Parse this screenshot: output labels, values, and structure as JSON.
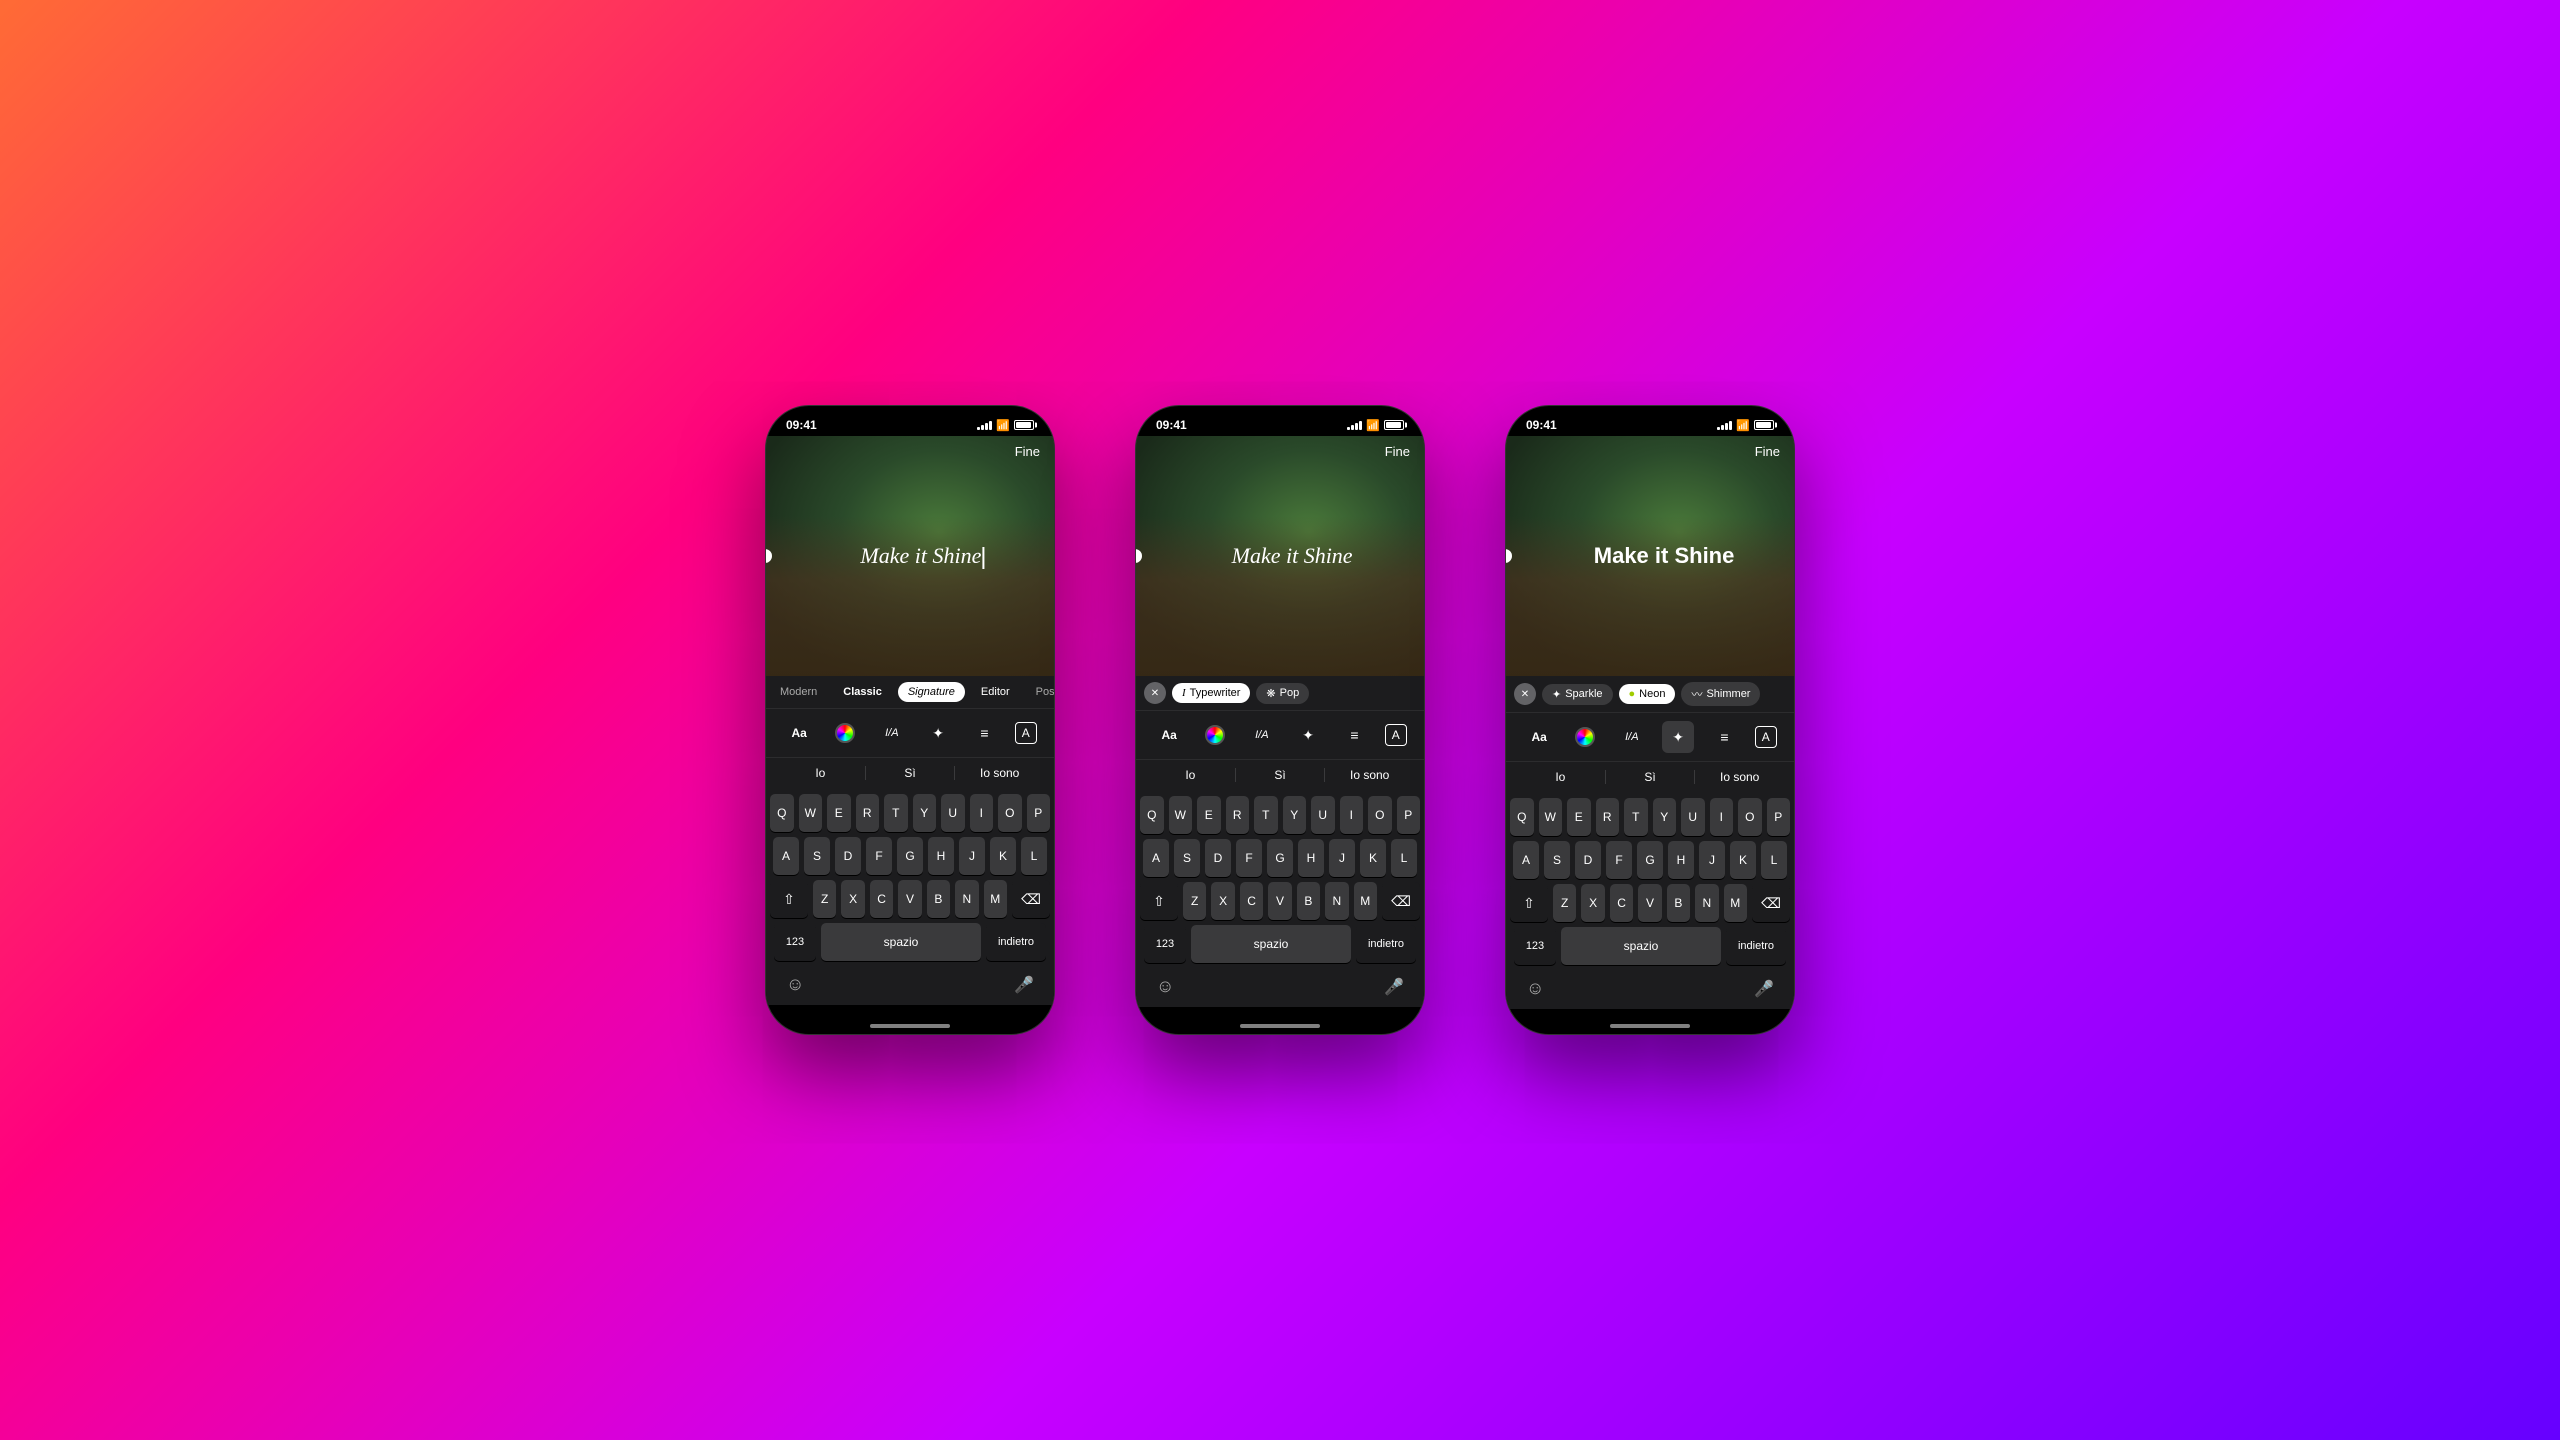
{
  "background": {
    "gradient": "linear-gradient(135deg, #ff6b35 0%, #ff0080 30%, #c800ff 60%, #6600ff 100%)"
  },
  "phones": [
    {
      "id": "phone1",
      "status": {
        "time": "09:41",
        "fine_btn": "Fine"
      },
      "text_overlay": "Make it Shine",
      "text_style": "italic",
      "has_cursor": true,
      "font_selector": {
        "type": "tabs",
        "items": [
          "Modern",
          "Classic",
          "Signature",
          "Editor",
          "Pos"
        ],
        "active": "Signature"
      },
      "toolbar": {
        "items": [
          "Aa",
          "color",
          "I/A",
          "effects",
          "align",
          "A-box"
        ]
      },
      "autocomplete": [
        "Io",
        "Sì",
        "Io sono"
      ],
      "keyboard_rows": [
        [
          "Q",
          "W",
          "E",
          "R",
          "T",
          "Y",
          "U",
          "I",
          "O",
          "P"
        ],
        [
          "A",
          "S",
          "D",
          "F",
          "G",
          "H",
          "J",
          "K",
          "L"
        ],
        [
          "⇧",
          "Z",
          "X",
          "C",
          "V",
          "B",
          "N",
          "M",
          "⌫"
        ],
        [
          "123",
          "spazio",
          "indietro"
        ]
      ],
      "bottom_icons": [
        "emoji",
        "mic"
      ]
    },
    {
      "id": "phone2",
      "status": {
        "time": "09:41",
        "fine_btn": "Fine"
      },
      "text_overlay": "Make it Shine",
      "text_style": "italic",
      "has_cursor": false,
      "font_selector": {
        "type": "pills-with-close",
        "items": [
          "Typewriter",
          "Pop"
        ],
        "active": "Typewriter",
        "show_close": true,
        "typewriter_icon": "I"
      },
      "toolbar": {
        "items": [
          "Aa",
          "color",
          "I/A",
          "effects",
          "align",
          "A-box"
        ]
      },
      "autocomplete": [
        "Io",
        "Sì",
        "Io sono"
      ],
      "keyboard_rows": [
        [
          "Q",
          "W",
          "E",
          "R",
          "T",
          "Y",
          "U",
          "I",
          "O",
          "P"
        ],
        [
          "A",
          "S",
          "D",
          "F",
          "G",
          "H",
          "J",
          "K",
          "L"
        ],
        [
          "⇧",
          "Z",
          "X",
          "C",
          "V",
          "B",
          "N",
          "M",
          "⌫"
        ],
        [
          "123",
          "spazio",
          "indietro"
        ]
      ],
      "bottom_icons": [
        "emoji",
        "mic"
      ]
    },
    {
      "id": "phone3",
      "status": {
        "time": "09:41",
        "fine_btn": "Fine"
      },
      "text_overlay": "Make it Shine",
      "text_style": "bold",
      "has_cursor": false,
      "font_selector": {
        "type": "pills-with-close",
        "items": [
          "Sparkle",
          "Neon",
          "Shimmer"
        ],
        "active": "Neon",
        "show_close": true
      },
      "toolbar": {
        "items": [
          "Aa",
          "color",
          "I/A",
          "effects",
          "align",
          "A-box"
        ]
      },
      "autocomplete": [
        "Io",
        "Sì",
        "Io sono"
      ],
      "keyboard_rows": [
        [
          "Q",
          "W",
          "E",
          "R",
          "T",
          "Y",
          "U",
          "I",
          "O",
          "P"
        ],
        [
          "A",
          "S",
          "D",
          "F",
          "G",
          "H",
          "J",
          "K",
          "L"
        ],
        [
          "⇧",
          "Z",
          "X",
          "C",
          "V",
          "B",
          "N",
          "M",
          "⌫"
        ],
        [
          "123",
          "spazio",
          "indietro"
        ]
      ],
      "bottom_icons": [
        "emoji",
        "mic"
      ]
    }
  ]
}
